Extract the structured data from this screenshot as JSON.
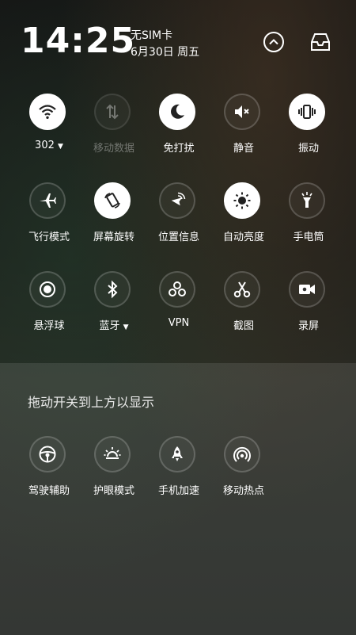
{
  "status": {
    "time": "14:25",
    "sim": "无SIM卡",
    "date": "6月30日 周五"
  },
  "header_buttons": [
    "collapse-up-icon",
    "inbox-tray-icon"
  ],
  "toggles": [
    {
      "label": "302",
      "icon": "wifi-icon",
      "active": true,
      "dropdown": true
    },
    {
      "label": "移动数据",
      "icon": "mobile-data-icon",
      "active": false,
      "disabled": true
    },
    {
      "label": "免打扰",
      "icon": "moon-icon",
      "active": true
    },
    {
      "label": "静音",
      "icon": "mute-icon",
      "active": false
    },
    {
      "label": "振动",
      "icon": "vibrate-icon",
      "active": true
    },
    {
      "label": "飞行模式",
      "icon": "airplane-icon",
      "active": false
    },
    {
      "label": "屏幕旋转",
      "icon": "rotate-icon",
      "active": true
    },
    {
      "label": "位置信息",
      "icon": "location-icon",
      "active": false
    },
    {
      "label": "自动亮度",
      "icon": "brightness-icon",
      "active": true
    },
    {
      "label": "手电筒",
      "icon": "flashlight-icon",
      "active": false
    },
    {
      "label": "悬浮球",
      "icon": "float-ball-icon",
      "active": false
    },
    {
      "label": "蓝牙",
      "icon": "bluetooth-icon",
      "active": false,
      "dropdown": true
    },
    {
      "label": "VPN",
      "icon": "vpn-icon",
      "active": false
    },
    {
      "label": "截图",
      "icon": "screenshot-icon",
      "active": false
    },
    {
      "label": "录屏",
      "icon": "screen-record-icon",
      "active": false
    }
  ],
  "panel": {
    "title": "拖动开关到上方以显示",
    "items": [
      {
        "label": "驾驶辅助",
        "icon": "steering-wheel-icon"
      },
      {
        "label": "护眼模式",
        "icon": "eye-care-icon"
      },
      {
        "label": "手机加速",
        "icon": "rocket-icon"
      },
      {
        "label": "移动热点",
        "icon": "hotspot-icon"
      }
    ]
  }
}
